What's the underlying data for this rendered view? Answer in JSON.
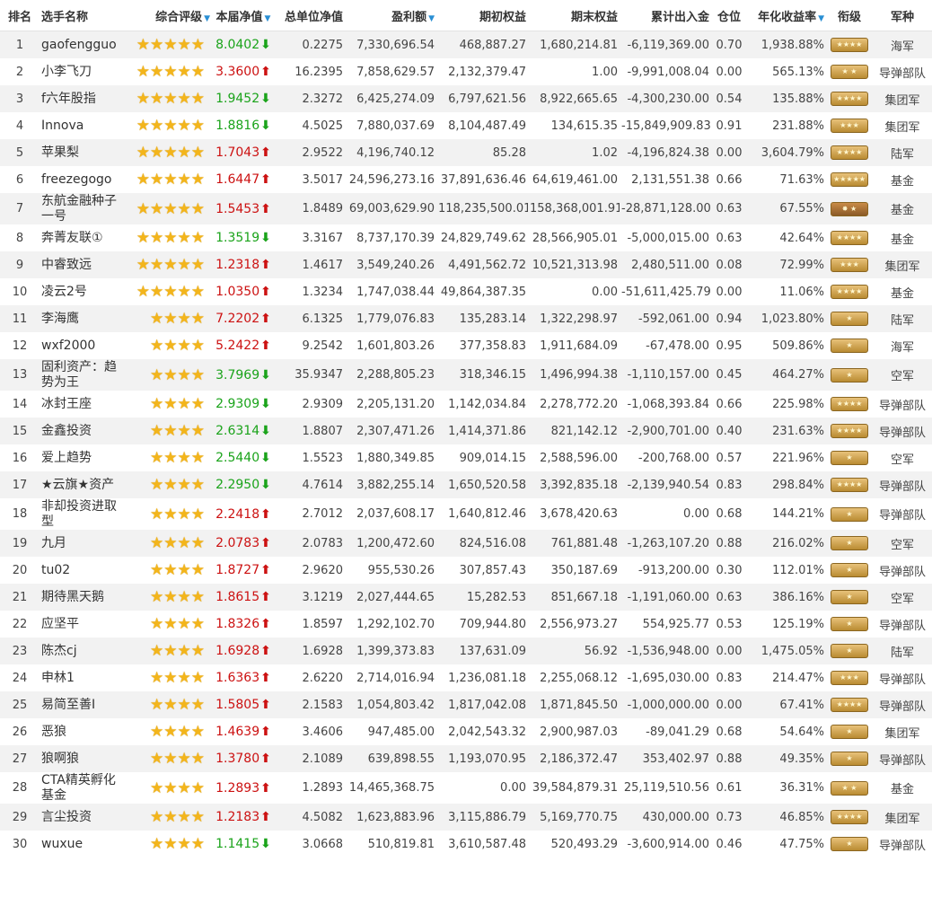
{
  "headers": {
    "rank": "排名",
    "player": "选手名称",
    "rating": "综合评级",
    "nav": "本届净值",
    "total_nav": "总单位净值",
    "profit": "盈利额",
    "begin": "期初权益",
    "end": "期末权益",
    "inout": "累计出入金",
    "position": "仓位",
    "annual": "年化收益率",
    "rank_title": "衔级",
    "army": "军种"
  },
  "sort_icon": "triangle-down-icon",
  "colors": {
    "up": "#cc1111",
    "down": "#1aa31a",
    "star": "#f3b51b",
    "header_sort": "#2a8fd4"
  },
  "rows": [
    {
      "rank": "1",
      "name": "gaofengguo",
      "stars": 5,
      "nav": "8.0402",
      "dir": "down",
      "total_nav": "0.2275",
      "profit": "7,330,696.54",
      "begin": "468,887.27",
      "end": "1,680,214.81",
      "inout": "-6,119,369.00",
      "position": "0.70",
      "annual": "1,938.88%",
      "badge": "★★★★",
      "army": "海军"
    },
    {
      "rank": "2",
      "name": "小李飞刀",
      "stars": 5,
      "nav": "3.3600",
      "dir": "up",
      "total_nav": "16.2395",
      "profit": "7,858,629.57",
      "begin": "2,132,379.47",
      "end": "1.00",
      "inout": "-9,991,008.04",
      "position": "0.00",
      "annual": "565.13%",
      "badge": "★ ★",
      "army": "导弹部队"
    },
    {
      "rank": "3",
      "name": "f六年股指",
      "stars": 5,
      "nav": "1.9452",
      "dir": "down",
      "total_nav": "2.3272",
      "profit": "6,425,274.09",
      "begin": "6,797,621.56",
      "end": "8,922,665.65",
      "inout": "-4,300,230.00",
      "position": "0.54",
      "annual": "135.88%",
      "badge": "★★★★",
      "army": "集团军"
    },
    {
      "rank": "4",
      "name": "Innova",
      "stars": 5,
      "nav": "1.8816",
      "dir": "down",
      "total_nav": "4.5025",
      "profit": "7,880,037.69",
      "begin": "8,104,487.49",
      "end": "134,615.35",
      "inout": "-15,849,909.83",
      "position": "0.91",
      "annual": "231.88%",
      "badge": "★★★",
      "army": "集团军"
    },
    {
      "rank": "5",
      "name": "苹果梨",
      "stars": 5,
      "nav": "1.7043",
      "dir": "up",
      "total_nav": "2.9522",
      "profit": "4,196,740.12",
      "begin": "85.28",
      "end": "1.02",
      "inout": "-4,196,824.38",
      "position": "0.00",
      "annual": "3,604.79%",
      "badge": "★★★★",
      "army": "陆军"
    },
    {
      "rank": "6",
      "name": "freezegogo",
      "stars": 5,
      "nav": "1.6447",
      "dir": "up",
      "total_nav": "3.5017",
      "profit": "24,596,273.16",
      "begin": "37,891,636.46",
      "end": "64,619,461.00",
      "inout": "2,131,551.38",
      "position": "0.66",
      "annual": "71.63%",
      "badge": "★★★★★",
      "army": "基金"
    },
    {
      "rank": "7",
      "name": "东航金融种子一号",
      "stars": 5,
      "nav": "1.5453",
      "dir": "up",
      "total_nav": "1.8489",
      "profit": "69,003,629.90",
      "begin": "118,235,500.01",
      "end": "158,368,001.91",
      "inout": "-28,871,128.00",
      "position": "0.63",
      "annual": "67.55%",
      "badge": "✸ ★",
      "army": "基金"
    },
    {
      "rank": "8",
      "name": "奔菁友联①",
      "stars": 5,
      "nav": "1.3519",
      "dir": "down",
      "total_nav": "3.3167",
      "profit": "8,737,170.39",
      "begin": "24,829,749.62",
      "end": "28,566,905.01",
      "inout": "-5,000,015.00",
      "position": "0.63",
      "annual": "42.64%",
      "badge": "★★★★",
      "army": "基金"
    },
    {
      "rank": "9",
      "name": "中睿致远",
      "stars": 5,
      "nav": "1.2318",
      "dir": "up",
      "total_nav": "1.4617",
      "profit": "3,549,240.26",
      "begin": "4,491,562.72",
      "end": "10,521,313.98",
      "inout": "2,480,511.00",
      "position": "0.08",
      "annual": "72.99%",
      "badge": "★★★",
      "army": "集团军"
    },
    {
      "rank": "10",
      "name": "凌云2号",
      "stars": 5,
      "nav": "1.0350",
      "dir": "up",
      "total_nav": "1.3234",
      "profit": "1,747,038.44",
      "begin": "49,864,387.35",
      "end": "0.00",
      "inout": "-51,611,425.79",
      "position": "0.00",
      "annual": "11.06%",
      "badge": "★★★★",
      "army": "基金"
    },
    {
      "rank": "11",
      "name": "李海鹰",
      "stars": 4,
      "nav": "7.2202",
      "dir": "up",
      "total_nav": "6.1325",
      "profit": "1,779,076.83",
      "begin": "135,283.14",
      "end": "1,322,298.97",
      "inout": "-592,061.00",
      "position": "0.94",
      "annual": "1,023.80%",
      "badge": "★",
      "army": "陆军"
    },
    {
      "rank": "12",
      "name": "wxf2000",
      "stars": 4,
      "nav": "5.2422",
      "dir": "up",
      "total_nav": "9.2542",
      "profit": "1,601,803.26",
      "begin": "377,358.83",
      "end": "1,911,684.09",
      "inout": "-67,478.00",
      "position": "0.95",
      "annual": "509.86%",
      "badge": "★",
      "army": "海军"
    },
    {
      "rank": "13",
      "name": "固利资产：趋势为王",
      "stars": 4,
      "nav": "3.7969",
      "dir": "down",
      "total_nav": "35.9347",
      "profit": "2,288,805.23",
      "begin": "318,346.15",
      "end": "1,496,994.38",
      "inout": "-1,110,157.00",
      "position": "0.45",
      "annual": "464.27%",
      "badge": "★",
      "army": "空军"
    },
    {
      "rank": "14",
      "name": "冰封王座",
      "stars": 4,
      "nav": "2.9309",
      "dir": "down",
      "total_nav": "2.9309",
      "profit": "2,205,131.20",
      "begin": "1,142,034.84",
      "end": "2,278,772.20",
      "inout": "-1,068,393.84",
      "position": "0.66",
      "annual": "225.98%",
      "badge": "★★★★",
      "army": "导弹部队"
    },
    {
      "rank": "15",
      "name": "金鑫投资",
      "stars": 4,
      "nav": "2.6314",
      "dir": "down",
      "total_nav": "1.8807",
      "profit": "2,307,471.26",
      "begin": "1,414,371.86",
      "end": "821,142.12",
      "inout": "-2,900,701.00",
      "position": "0.40",
      "annual": "231.63%",
      "badge": "★★★★",
      "army": "导弹部队"
    },
    {
      "rank": "16",
      "name": "爱上趋势",
      "stars": 4,
      "nav": "2.5440",
      "dir": "down",
      "total_nav": "1.5523",
      "profit": "1,880,349.85",
      "begin": "909,014.15",
      "end": "2,588,596.00",
      "inout": "-200,768.00",
      "position": "0.57",
      "annual": "221.96%",
      "badge": "★",
      "army": "空军"
    },
    {
      "rank": "17",
      "name": "★云旗★资产",
      "stars": 4,
      "nav": "2.2950",
      "dir": "down",
      "total_nav": "4.7614",
      "profit": "3,882,255.14",
      "begin": "1,650,520.58",
      "end": "3,392,835.18",
      "inout": "-2,139,940.54",
      "position": "0.83",
      "annual": "298.84%",
      "badge": "★★★★",
      "army": "导弹部队"
    },
    {
      "rank": "18",
      "name": "非却投资进取型",
      "stars": 4,
      "nav": "2.2418",
      "dir": "up",
      "total_nav": "2.7012",
      "profit": "2,037,608.17",
      "begin": "1,640,812.46",
      "end": "3,678,420.63",
      "inout": "0.00",
      "position": "0.68",
      "annual": "144.21%",
      "badge": "★",
      "army": "导弹部队"
    },
    {
      "rank": "19",
      "name": "九月",
      "stars": 4,
      "nav": "2.0783",
      "dir": "up",
      "total_nav": "2.0783",
      "profit": "1,200,472.60",
      "begin": "824,516.08",
      "end": "761,881.48",
      "inout": "-1,263,107.20",
      "position": "0.88",
      "annual": "216.02%",
      "badge": "★",
      "army": "空军"
    },
    {
      "rank": "20",
      "name": "tu02",
      "stars": 4,
      "nav": "1.8727",
      "dir": "up",
      "total_nav": "2.9620",
      "profit": "955,530.26",
      "begin": "307,857.43",
      "end": "350,187.69",
      "inout": "-913,200.00",
      "position": "0.30",
      "annual": "112.01%",
      "badge": "★",
      "army": "导弹部队"
    },
    {
      "rank": "21",
      "name": "期待黑天鹅",
      "stars": 4,
      "nav": "1.8615",
      "dir": "up",
      "total_nav": "3.1219",
      "profit": "2,027,444.65",
      "begin": "15,282.53",
      "end": "851,667.18",
      "inout": "-1,191,060.00",
      "position": "0.63",
      "annual": "386.16%",
      "badge": "★",
      "army": "空军"
    },
    {
      "rank": "22",
      "name": "应坚平",
      "stars": 4,
      "nav": "1.8326",
      "dir": "up",
      "total_nav": "1.8597",
      "profit": "1,292,102.70",
      "begin": "709,944.80",
      "end": "2,556,973.27",
      "inout": "554,925.77",
      "position": "0.53",
      "annual": "125.19%",
      "badge": "★",
      "army": "导弹部队"
    },
    {
      "rank": "23",
      "name": "陈杰cj",
      "stars": 4,
      "nav": "1.6928",
      "dir": "up",
      "total_nav": "1.6928",
      "profit": "1,399,373.83",
      "begin": "137,631.09",
      "end": "56.92",
      "inout": "-1,536,948.00",
      "position": "0.00",
      "annual": "1,475.05%",
      "badge": "★",
      "army": "陆军"
    },
    {
      "rank": "24",
      "name": "申林1",
      "stars": 4,
      "nav": "1.6363",
      "dir": "up",
      "total_nav": "2.6220",
      "profit": "2,714,016.94",
      "begin": "1,236,081.18",
      "end": "2,255,068.12",
      "inout": "-1,695,030.00",
      "position": "0.83",
      "annual": "214.47%",
      "badge": "★★★",
      "army": "导弹部队"
    },
    {
      "rank": "25",
      "name": "易简至善I",
      "stars": 4,
      "nav": "1.5805",
      "dir": "up",
      "total_nav": "2.1583",
      "profit": "1,054,803.42",
      "begin": "1,817,042.08",
      "end": "1,871,845.50",
      "inout": "-1,000,000.00",
      "position": "0.00",
      "annual": "67.41%",
      "badge": "★★★★",
      "army": "导弹部队"
    },
    {
      "rank": "26",
      "name": "恶狼",
      "stars": 4,
      "nav": "1.4639",
      "dir": "up",
      "total_nav": "3.4606",
      "profit": "947,485.00",
      "begin": "2,042,543.32",
      "end": "2,900,987.03",
      "inout": "-89,041.29",
      "position": "0.68",
      "annual": "54.64%",
      "badge": "★",
      "army": "集团军"
    },
    {
      "rank": "27",
      "name": "狼啊狼",
      "stars": 4,
      "nav": "1.3780",
      "dir": "up",
      "total_nav": "2.1089",
      "profit": "639,898.55",
      "begin": "1,193,070.95",
      "end": "2,186,372.47",
      "inout": "353,402.97",
      "position": "0.88",
      "annual": "49.35%",
      "badge": "★",
      "army": "导弹部队"
    },
    {
      "rank": "28",
      "name": "CTA精英孵化基金",
      "stars": 4,
      "nav": "1.2893",
      "dir": "up",
      "total_nav": "1.2893",
      "profit": "14,465,368.75",
      "begin": "0.00",
      "end": "39,584,879.31",
      "inout": "25,119,510.56",
      "position": "0.61",
      "annual": "36.31%",
      "badge": "★ ★",
      "army": "基金"
    },
    {
      "rank": "29",
      "name": "言尘投资",
      "stars": 4,
      "nav": "1.2183",
      "dir": "up",
      "total_nav": "4.5082",
      "profit": "1,623,883.96",
      "begin": "3,115,886.79",
      "end": "5,169,770.75",
      "inout": "430,000.00",
      "position": "0.73",
      "annual": "46.85%",
      "badge": "★★★★",
      "army": "集团军"
    },
    {
      "rank": "30",
      "name": "wuxue",
      "stars": 4,
      "nav": "1.1415",
      "dir": "down",
      "total_nav": "3.0668",
      "profit": "510,819.81",
      "begin": "3,610,587.48",
      "end": "520,493.29",
      "inout": "-3,600,914.00",
      "position": "0.46",
      "annual": "47.75%",
      "badge": "★",
      "army": "导弹部队"
    }
  ]
}
